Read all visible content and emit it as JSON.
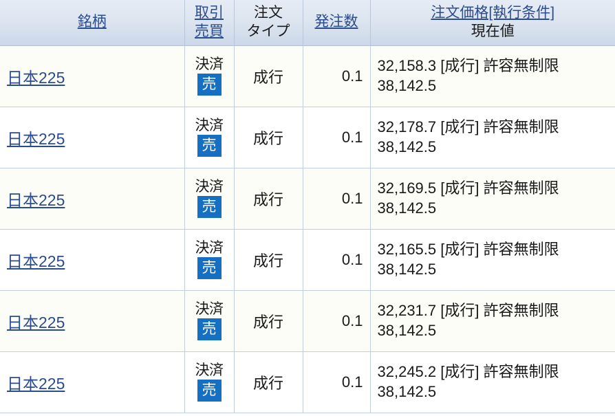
{
  "table": {
    "columns": [
      {
        "key": "symbol",
        "label_link": "銘柄 ",
        "label_sub": ""
      },
      {
        "key": "side",
        "label_link": "取引",
        "label_link2": "売買"
      },
      {
        "key": "order_type",
        "label_line1": "注文",
        "label_line2": "タイプ"
      },
      {
        "key": "quantity",
        "label_link": "発注数",
        "label_sub": ""
      },
      {
        "key": "price",
        "label_link": "注文価格[執行条件]",
        "label_sub": "現在値"
      }
    ],
    "rows": [
      {
        "symbol": "日本225",
        "side_label": "決済",
        "side_badge": "売",
        "order_type": "成行",
        "quantity": "0.1",
        "price_order": "32,158.3 [成行] 許容無制限",
        "price_current": "38,142.5"
      },
      {
        "symbol": "日本225",
        "side_label": "決済",
        "side_badge": "売",
        "order_type": "成行",
        "quantity": "0.1",
        "price_order": "32,178.7 [成行] 許容無制限",
        "price_current": "38,142.5"
      },
      {
        "symbol": "日本225",
        "side_label": "決済",
        "side_badge": "売",
        "order_type": "成行",
        "quantity": "0.1",
        "price_order": "32,169.5 [成行] 許容無制限",
        "price_current": "38,142.5"
      },
      {
        "symbol": "日本225",
        "side_label": "決済",
        "side_badge": "売",
        "order_type": "成行",
        "quantity": "0.1",
        "price_order": "32,165.5 [成行] 許容無制限",
        "price_current": "38,142.5"
      },
      {
        "symbol": "日本225",
        "side_label": "決済",
        "side_badge": "売",
        "order_type": "成行",
        "quantity": "0.1",
        "price_order": "32,231.7 [成行] 許容無制限",
        "price_current": "38,142.5"
      },
      {
        "symbol": "日本225",
        "side_label": "決済",
        "side_badge": "売",
        "order_type": "成行",
        "quantity": "0.1",
        "price_order": "32,245.2 [成行] 許容無制限",
        "price_current": "38,142.5"
      }
    ]
  },
  "colors": {
    "link": "#2b4b8f",
    "badge_sell": "#1570c4",
    "header_top": "#e6ecf5",
    "header_bottom": "#ccd8e8",
    "border": "#c3cedd",
    "row_odd": "#fdfdf8",
    "row_even": "#ffffff"
  }
}
